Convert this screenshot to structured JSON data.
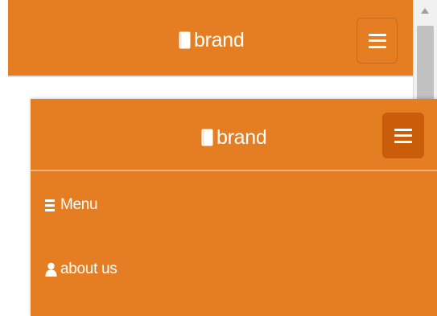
{
  "top_navbar": {
    "brand_label": "brand",
    "brand_icon": "book-icon",
    "toggle_icon": "hamburger-icon"
  },
  "expanded_navbar": {
    "brand_label": "brand",
    "brand_icon": "book-icon",
    "toggle_icon": "hamburger-icon",
    "items": [
      {
        "label": "Menu",
        "icon": "list-icon"
      },
      {
        "label": "about us",
        "icon": "user-icon"
      }
    ]
  },
  "colors": {
    "navbar_background": "#e57e22",
    "toggle_active_background": "#c95d0a",
    "text": "#ffffff"
  }
}
